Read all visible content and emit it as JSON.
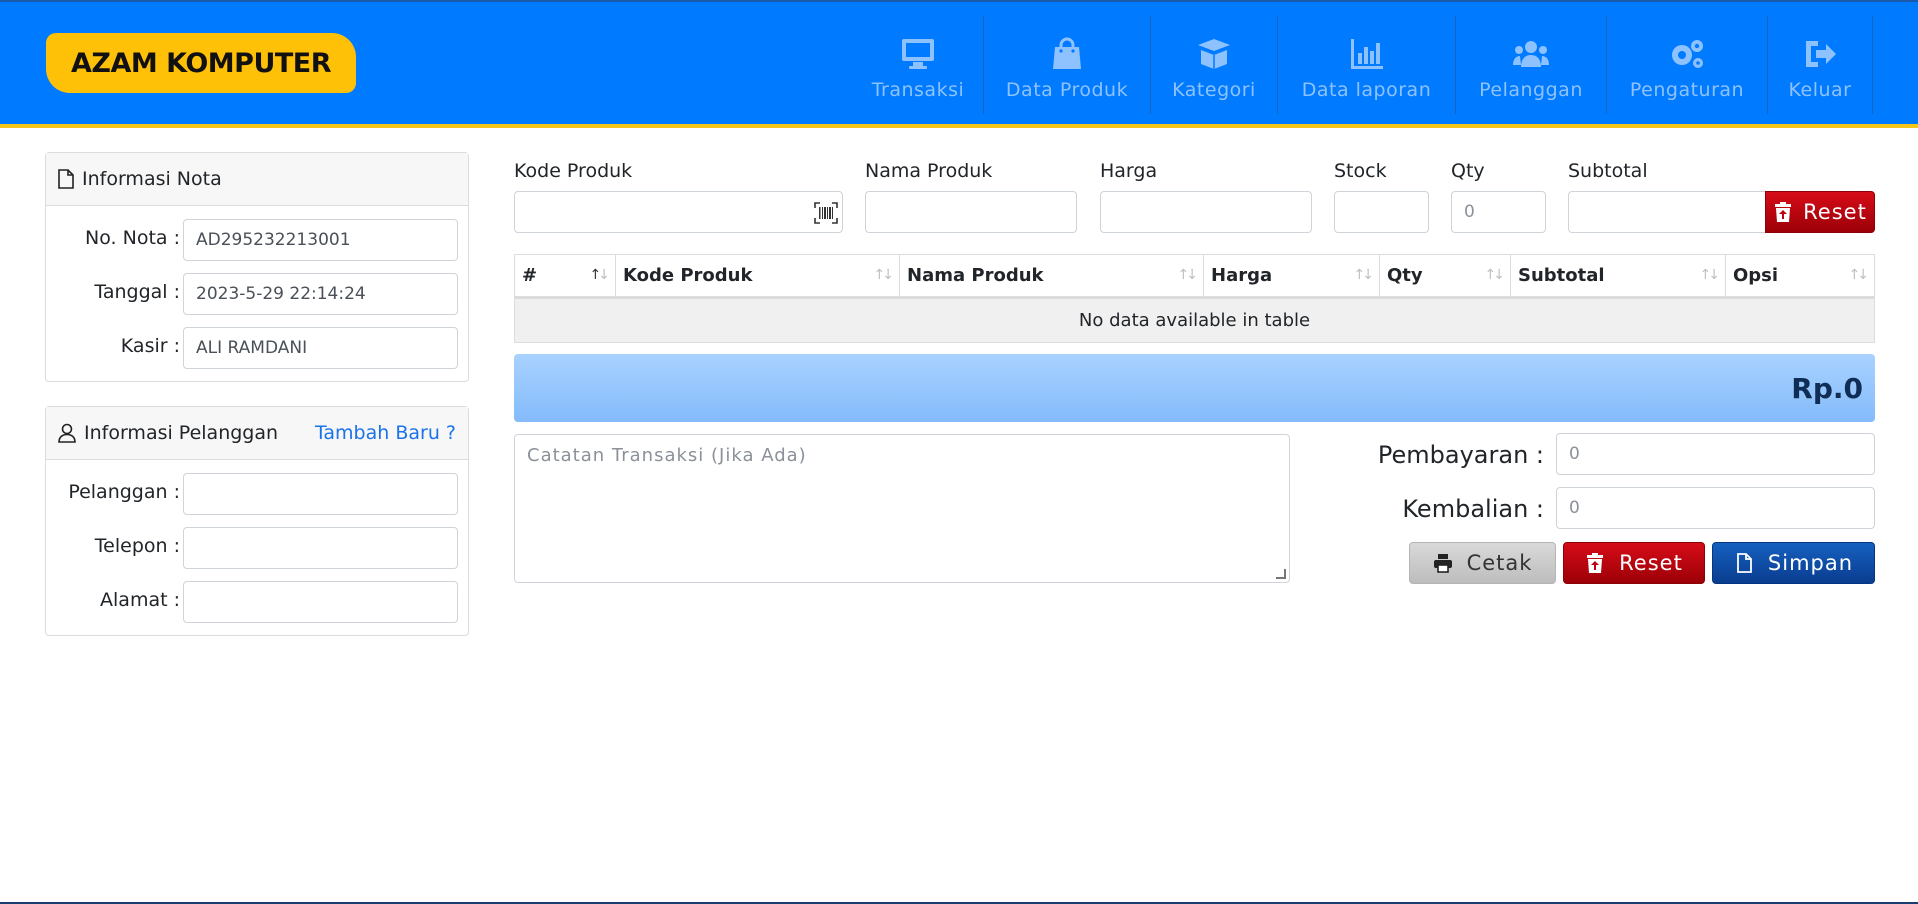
{
  "brand": {
    "name": "AZAM KOMPUTER"
  },
  "nav": [
    {
      "label": "Transaksi",
      "icon": "desktop-icon"
    },
    {
      "label": "Data Produk",
      "icon": "shopping-bag-icon"
    },
    {
      "label": "Kategori",
      "icon": "box-open-icon"
    },
    {
      "label": "Data laporan",
      "icon": "bar-chart-icon"
    },
    {
      "label": "Pelanggan",
      "icon": "users-icon"
    },
    {
      "label": "Pengaturan",
      "icon": "gears-icon"
    },
    {
      "label": "Keluar",
      "icon": "sign-out-icon"
    }
  ],
  "nota": {
    "title": "Informasi Nota",
    "no_label": "No. Nota :",
    "no_value": "AD295232213001",
    "tanggal_label": "Tanggal :",
    "tanggal_value": "2023-5-29 22:14:24",
    "kasir_label": "Kasir :",
    "kasir_value": "ALI RAMDANI"
  },
  "pelanggan": {
    "title": "Informasi Pelanggan",
    "add_link": "Tambah Baru ?",
    "pelanggan_label": "Pelanggan :",
    "telepon_label": "Telepon :",
    "alamat_label": "Alamat :"
  },
  "entry": {
    "kode_label": "Kode Produk",
    "nama_label": "Nama Produk",
    "harga_label": "Harga",
    "stock_label": "Stock",
    "qty_label": "Qty",
    "qty_placeholder": "0",
    "subtotal_label": "Subtotal",
    "reset_label": "Reset"
  },
  "table": {
    "columns": [
      "#",
      "Kode Produk",
      "Nama Produk",
      "Harga",
      "Qty",
      "Subtotal",
      "Opsi"
    ],
    "empty_text": "No data available in table"
  },
  "total": {
    "value": "Rp.0"
  },
  "notes": {
    "placeholder": "Catatan Transaksi (Jika Ada)"
  },
  "payment": {
    "pembayaran_label": "Pembayaran :",
    "pembayaran_placeholder": "0",
    "kembalian_label": "Kembalian :",
    "kembalian_placeholder": "0"
  },
  "actions": {
    "cetak": "Cetak",
    "reset": "Reset",
    "simpan": "Simpan"
  },
  "colors": {
    "header": "#007bff",
    "brand": "#ffc107",
    "danger": "#c00010",
    "primary": "#0d4ea6"
  }
}
